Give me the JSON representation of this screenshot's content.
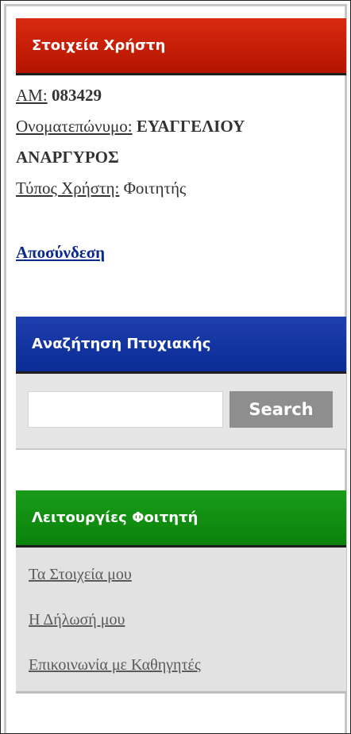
{
  "user_panel": {
    "title": "Στοιχεία Χρήστη",
    "am_label": "ΑΜ:",
    "am_value": "083429",
    "name_label": "Ονοματεπώνυμο:",
    "name_value_line1": "ΕΥΑΓΓΕΛΙΟΥ",
    "name_value_line2": "ΑΝΑΡΓΥΡΟΣ",
    "type_label": "Τύπος Χρήστη:",
    "type_value": "Φοιτητής",
    "logout_label": "Αποσύνδεση"
  },
  "search_panel": {
    "title": "Αναζήτηση Πτυχιακής",
    "input_value": "",
    "button_label": "Search"
  },
  "student_panel": {
    "title": "Λειτουργίες Φοιτητή",
    "items": [
      {
        "label": "Τα Στοιχεία μου"
      },
      {
        "label": "Η Δήλωσή μου"
      },
      {
        "label": "Επικοινωνία με Καθηγητές"
      }
    ]
  },
  "colors": {
    "user_header": "#c81e08",
    "search_header": "#0a2c94",
    "student_header": "#0a820a",
    "search_button": "#8e8e8e"
  }
}
